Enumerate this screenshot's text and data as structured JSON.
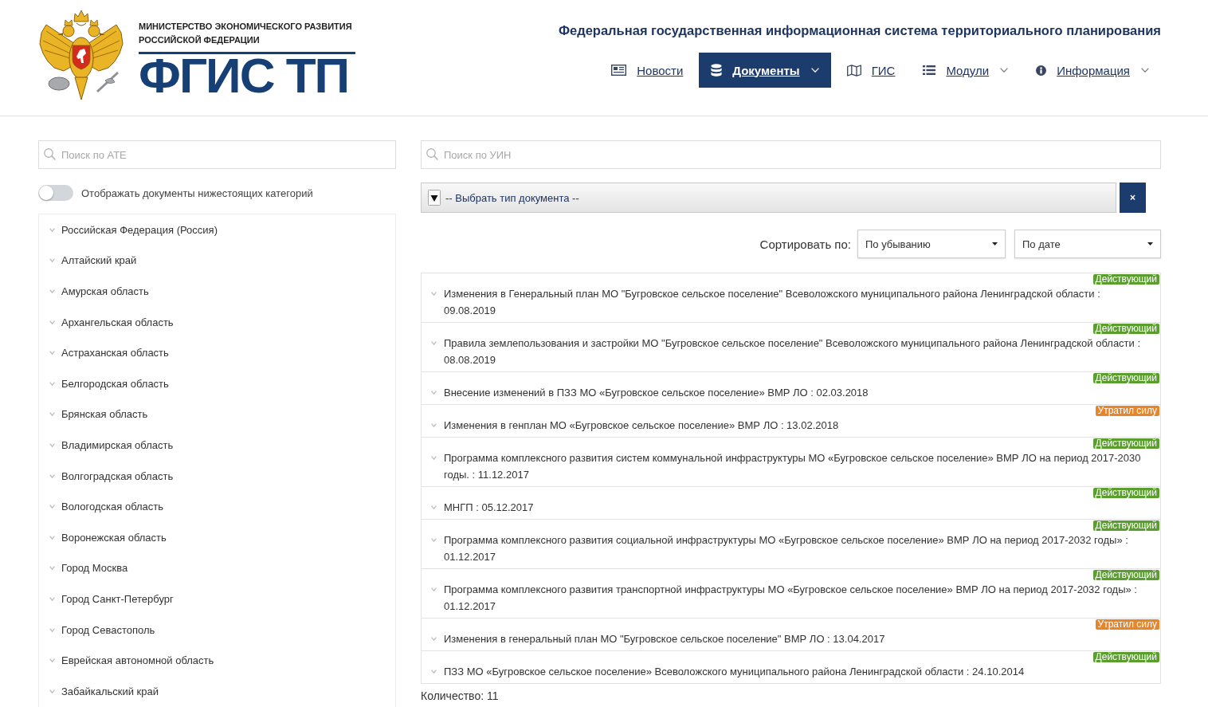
{
  "header": {
    "ministry": "МИНИСТЕРСТВО ЭКОНОМИЧЕСКОГО РАЗВИТИЯ РОССИЙСКОЙ ФЕДЕРАЦИИ",
    "logo_text": "ФГИС ТП",
    "title": "Федеральная государственная информационная система территориального планирования"
  },
  "nav": [
    {
      "label": "Новости",
      "selected": false,
      "dropdown": false
    },
    {
      "label": "Документы",
      "selected": true,
      "dropdown": true
    },
    {
      "label": "ГИС",
      "selected": false,
      "dropdown": false
    },
    {
      "label": "Модули",
      "selected": false,
      "dropdown": true
    },
    {
      "label": "Информация",
      "selected": false,
      "dropdown": true
    }
  ],
  "sidebar": {
    "search": {
      "placeholder": "Поиск по АТЕ"
    },
    "toggle": {
      "label": "Отображать документы нижестоящих категорий",
      "on": false
    },
    "regions": [
      "Российская Федерация (Россия)",
      "Алтайский край",
      "Амурская область",
      "Архангельская область",
      "Астраханская область",
      "Белгородская область",
      "Брянская область",
      "Владимирская область",
      "Волгоградская область",
      "Вологодская область",
      "Воронежская область",
      "Город Москва",
      "Город Санкт-Петербург",
      "Город Севастополь",
      "Еврейская автономной область",
      "Забайкальский край"
    ]
  },
  "documents": {
    "search": {
      "placeholder": "Поиск по УИН"
    },
    "type_filter": {
      "value": "-- Выбрать тип документа --"
    },
    "clear_button": "×",
    "sort": {
      "label": "Сортировать по:",
      "selects": [
        {
          "value": "По убыванию"
        },
        {
          "value": "По дате"
        }
      ]
    },
    "items": [
      {
        "title": "Изменения в Генеральный план МО \"Бугровское сельское поселение\" Всеволожского муниципального района Ленинградской области : 09.08.2019",
        "status": {
          "label": "Действующий",
          "color": "#5a9e2e"
        }
      },
      {
        "title": "Правила землепользования и застройки МО \"Бугровское сельское поселение\" Всеволожского муниципального района Ленинградской области : 08.08.2019",
        "status": {
          "label": "Действующий",
          "color": "#5a9e2e"
        }
      },
      {
        "title": "Внесение изменений в ПЗЗ МО «Бугровское сельское поселение» ВМР ЛО : 02.03.2018",
        "status": {
          "label": "Действующий",
          "color": "#5a9e2e"
        }
      },
      {
        "title": "Изменения в генплан МО «Бугровское сельское поселение» ВМР ЛО : 13.02.2018",
        "status": {
          "label": "Утратил силу",
          "color": "#e8852b"
        }
      },
      {
        "title": "Программа комплексного развития систем коммунальной инфраструктуры МО «Бугровское сельское поселение» ВМР ЛО на период 2017-2030 годы. : 11.12.2017",
        "status": {
          "label": "Действующий",
          "color": "#5a9e2e"
        }
      },
      {
        "title": "МНГП : 05.12.2017",
        "status": {
          "label": "Действующий",
          "color": "#5a9e2e"
        }
      },
      {
        "title": "Программа комплексного развития социальной инфраструктуры МО «Бугровское сельское поселение» ВМР ЛО на период 2017-2032 годы» : 01.12.2017",
        "status": {
          "label": "Действующий",
          "color": "#5a9e2e"
        }
      },
      {
        "title": "Программа комплексного развития транспортной инфраструктуры МО «Бугровское сельское поселение» ВМР ЛО на период 2017-2032 годы» : 01.12.2017",
        "status": {
          "label": "Действующий",
          "color": "#5a9e2e"
        }
      },
      {
        "title": "Изменения в генеральный план МО \"Бугровское сельское поселение\" ВМР ЛО : 13.04.2017",
        "status": {
          "label": "Утратил силу",
          "color": "#e8852b"
        }
      },
      {
        "title": "ПЗЗ МО «Бугровское сельское поселение» Всеволожского муниципального района Ленинградской области : 24.10.2014",
        "status": {
          "label": "Действующий",
          "color": "#5a9e2e"
        }
      }
    ],
    "count": "Количество: 11"
  }
}
